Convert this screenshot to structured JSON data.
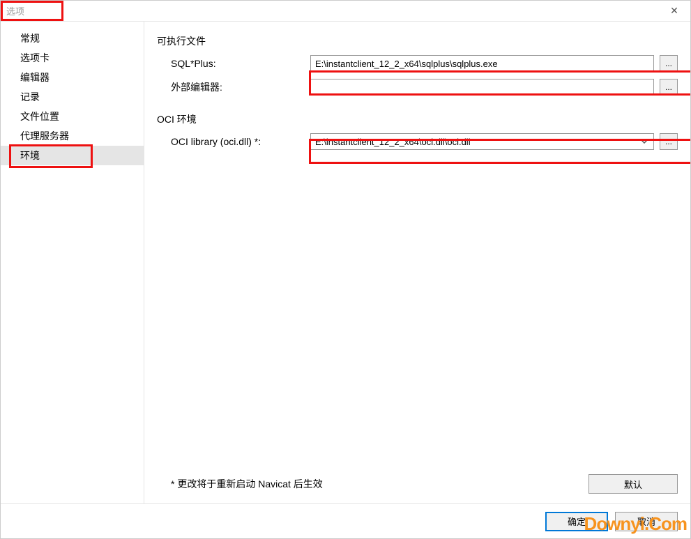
{
  "window": {
    "title": "选项",
    "close_icon": "✕"
  },
  "sidebar": {
    "items": [
      {
        "label": "常规"
      },
      {
        "label": "选项卡"
      },
      {
        "label": "编辑器"
      },
      {
        "label": "记录"
      },
      {
        "label": "文件位置"
      },
      {
        "label": "代理服务器"
      },
      {
        "label": "环境",
        "selected": true
      }
    ]
  },
  "content": {
    "section1_title": "可执行文件",
    "sqlplus_label": "SQL*Plus:",
    "sqlplus_value": "E:\\instantclient_12_2_x64\\sqlplus\\sqlplus.exe",
    "external_editor_label": "外部编辑器:",
    "external_editor_value": "",
    "section2_title": "OCI 环境",
    "oci_label": "OCI library (oci.dll) *:",
    "oci_value": "E:\\instantclient_12_2_x64\\oci.dll\\oci.dll",
    "browse_label": "...",
    "restart_note": "* 更改将于重新启动 Navicat 后生效",
    "default_button": "默认"
  },
  "footer": {
    "ok": "确定",
    "cancel": "取消"
  },
  "watermark": "Downyi.Com"
}
